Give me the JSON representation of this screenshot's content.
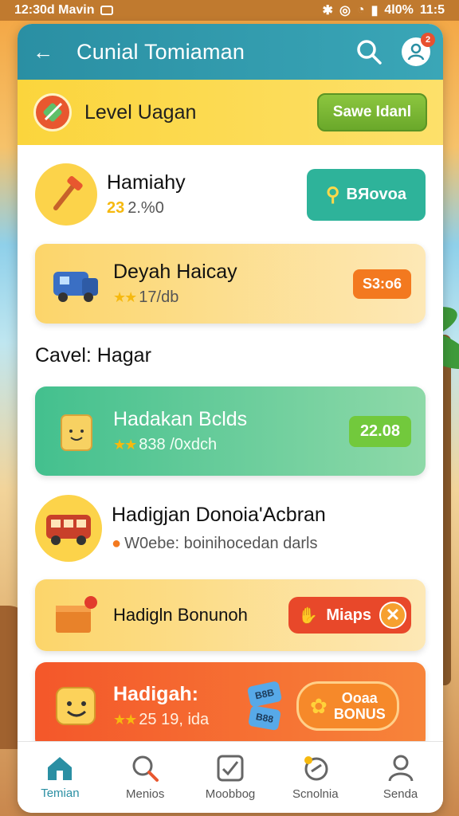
{
  "status_bar": {
    "time": "12:30d Mavin",
    "right": "4l0%",
    "battery": "11:5"
  },
  "header": {
    "title": "Cunial Tomiaman",
    "notification_count": "2"
  },
  "level": {
    "title": "Level Uagan",
    "save_label": "Sawe Idanl"
  },
  "items": [
    {
      "title": "Hamiahy",
      "sub": "2.%0",
      "sub_prefix": "23",
      "button": "BЯovoa"
    },
    {
      "title": "Deyah Haicay",
      "sub": "17/db",
      "badge": "S3:o6"
    }
  ],
  "section": {
    "heading": "Cavel: Hagar"
  },
  "green_card": {
    "title": "Hadakan Bclds",
    "sub": "838 /0xdch",
    "badge": "22.08"
  },
  "plain_item": {
    "title": "Hadigjan Donoia'Acbran",
    "sub": "W0ebe: boinihocedan darls"
  },
  "bonus_card": {
    "title": "Hadigln Bonunoh",
    "button": "Miaps"
  },
  "red_card": {
    "title": "Hadigah:",
    "sub": "25 19, ida",
    "tile_top": "B8B",
    "tile_bottom": "B88",
    "bonus_top": "Ooaa",
    "bonus_bottom": "BONUS"
  },
  "tabs": [
    {
      "label": "Temian",
      "icon": "home-icon",
      "active": true
    },
    {
      "label": "Menios",
      "icon": "search-icon",
      "active": false
    },
    {
      "label": "Moobbog",
      "icon": "checklist-icon",
      "active": false
    },
    {
      "label": "Scnolnia",
      "icon": "dice-icon",
      "active": false
    },
    {
      "label": "Senda",
      "icon": "person-icon",
      "active": false
    }
  ],
  "colors": {
    "teal": "#2a8fa3",
    "yellow": "#fbd53c",
    "green": "#43c08e",
    "red": "#f4572a",
    "accent_button": "#2eb39a"
  }
}
